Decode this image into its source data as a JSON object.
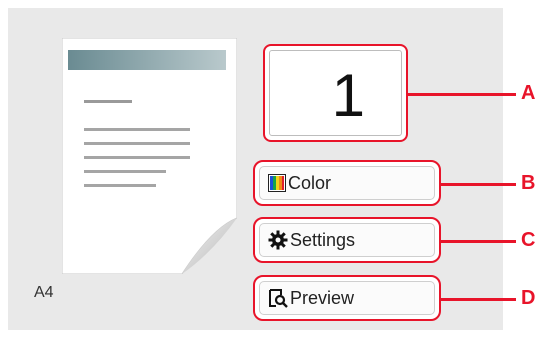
{
  "preview": {
    "paper_size": "A4"
  },
  "copies": {
    "value": "1"
  },
  "buttons": {
    "color": {
      "label": "Color",
      "icon": "color-bars-icon"
    },
    "settings": {
      "label": "Settings",
      "icon": "gear-icon"
    },
    "preview": {
      "label": "Preview",
      "icon": "page-magnifier-icon"
    }
  },
  "callouts": {
    "a": "A",
    "b": "B",
    "c": "C",
    "d": "D"
  },
  "colors": {
    "callout_red": "#e8142a",
    "panel_gray": "#e9e9e9"
  }
}
